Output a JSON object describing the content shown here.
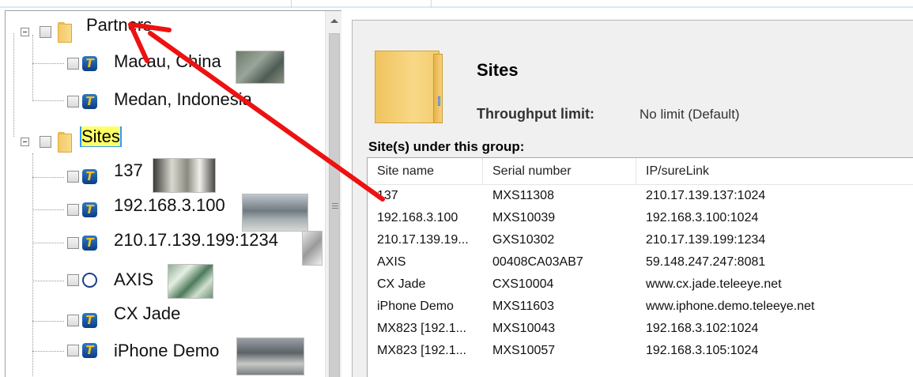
{
  "tree": {
    "nodes": [
      {
        "label": "Partners",
        "kind": "group",
        "selected": false
      },
      {
        "label": "Macau, China",
        "kind": "camera",
        "selected": false
      },
      {
        "label": "Medan, Indonesia",
        "kind": "camera",
        "selected": false
      },
      {
        "label": "Sites",
        "kind": "group",
        "selected": true
      },
      {
        "label": "137",
        "kind": "camera",
        "selected": false
      },
      {
        "label": "192.168.3.100",
        "kind": "camera",
        "selected": false
      },
      {
        "label": "210.17.139.199:1234",
        "kind": "camera",
        "selected": false
      },
      {
        "label": "AXIS",
        "kind": "axis-camera",
        "selected": false
      },
      {
        "label": "CX Jade",
        "kind": "camera",
        "selected": false
      },
      {
        "label": "iPhone Demo",
        "kind": "camera",
        "selected": false
      }
    ]
  },
  "detail": {
    "title": "Sites",
    "throughput_label": "Throughput limit:",
    "throughput_value": "No limit (Default)",
    "group_caption": "Site(s) under this group:"
  },
  "table": {
    "columns": [
      "Site name",
      "Serial number",
      "IP/sureLink"
    ],
    "rows": [
      [
        "137",
        "MXS11308",
        "210.17.139.137:1024"
      ],
      [
        "192.168.3.100",
        "MXS10039",
        "192.168.3.100:1024"
      ],
      [
        "210.17.139.19...",
        "GXS10302",
        "210.17.139.199:1234"
      ],
      [
        "AXIS",
        "00408CA03AB7",
        "59.148.247.247:8081"
      ],
      [
        "CX Jade",
        "CXS10004",
        "www.cx.jade.teleeye.net"
      ],
      [
        "iPhone Demo",
        "MXS11603",
        "www.iphone.demo.teleeye.net"
      ],
      [
        "MX823 [192.1...",
        "MXS10043",
        "192.168.3.102:1024"
      ],
      [
        "MX823 [192.1...",
        "MXS10057",
        "192.168.3.105:1024"
      ]
    ]
  },
  "colors": {
    "selection_highlight": "#3399ff",
    "label_highlight": "#ffff66",
    "annotation_arrow": "#ee1111",
    "camera_icon": "#0b3d86"
  },
  "icons": {
    "group": "folder-icon",
    "camera": "teleeye-t-icon",
    "axis-camera": "ring-icon"
  }
}
